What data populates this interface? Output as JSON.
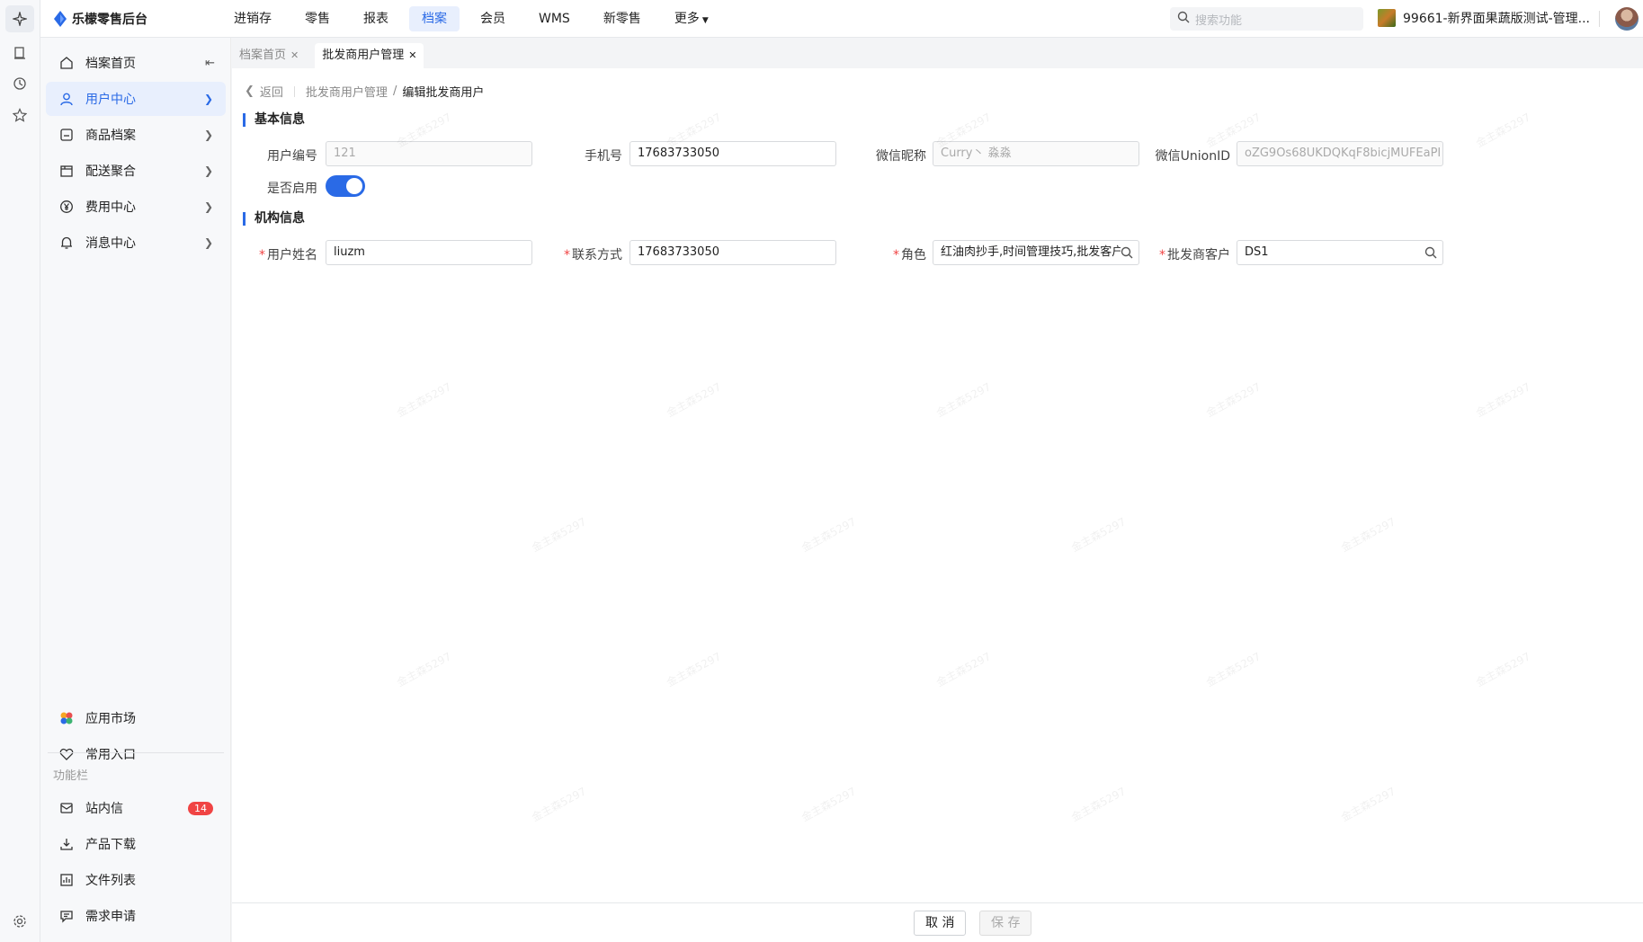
{
  "app": {
    "title": "乐檬零售后台",
    "brand_color": "#2a6ae6"
  },
  "topnav": {
    "items": [
      {
        "label": "进销存"
      },
      {
        "label": "零售"
      },
      {
        "label": "报表"
      },
      {
        "label": "档案",
        "active": true
      },
      {
        "label": "会员"
      },
      {
        "label": "WMS"
      },
      {
        "label": "新零售"
      },
      {
        "label": "更多"
      }
    ],
    "search_placeholder": "搜索功能",
    "store_name": "99661-新界面果蔬版测试-管理..."
  },
  "sidebar": {
    "items": [
      {
        "label": "档案首页",
        "icon": "home-icon"
      },
      {
        "label": "用户中心",
        "icon": "user-icon",
        "active": true
      },
      {
        "label": "商品档案",
        "icon": "goods-icon"
      },
      {
        "label": "配送聚合",
        "icon": "delivery-icon"
      },
      {
        "label": "费用中心",
        "icon": "yen-icon"
      },
      {
        "label": "消息中心",
        "icon": "bell-icon"
      }
    ],
    "bottom_items": [
      {
        "label": "应用市场",
        "icon": "app-market-icon"
      },
      {
        "label": "常用入口",
        "icon": "heart-icon"
      }
    ],
    "section_label": "功能栏",
    "function_items": [
      {
        "label": "站内信",
        "icon": "mail-icon",
        "badge": "14"
      },
      {
        "label": "产品下载",
        "icon": "download-icon"
      },
      {
        "label": "文件列表",
        "icon": "file-list-icon"
      },
      {
        "label": "需求申请",
        "icon": "request-icon"
      }
    ]
  },
  "tabs": [
    {
      "label": "档案首页"
    },
    {
      "label": "批发商用户管理",
      "active": true
    }
  ],
  "breadcrumb": {
    "back": "返回",
    "parent": "批发商用户管理",
    "separator": "/",
    "current": "编辑批发商用户"
  },
  "basic_info": {
    "title": "基本信息",
    "user_code_label": "用户编号",
    "user_code_value": "121",
    "phone_label": "手机号",
    "phone_value": "17683733050",
    "wechat_nick_label": "微信昵称",
    "wechat_nick_value": "Curry丶 淼淼",
    "unionid_label": "微信UnionID",
    "unionid_value": "oZG9Os68UKDQKqF8bicjMUFEaPI",
    "enabled_label": "是否启用",
    "enabled": true
  },
  "org_info": {
    "title": "机构信息",
    "required_mark": "*",
    "user_name_label": "用户姓名",
    "user_name_value": "liuzm",
    "contact_label": "联系方式",
    "contact_value": "17683733050",
    "role_label": "角色",
    "role_value": "红油肉抄手,时间管理技巧,批发客户",
    "customer_label": "批发商客户",
    "customer_value": "DS1"
  },
  "footer": {
    "cancel_label": "取 消",
    "save_label": "保 存"
  },
  "watermark_text": "金主森5297"
}
